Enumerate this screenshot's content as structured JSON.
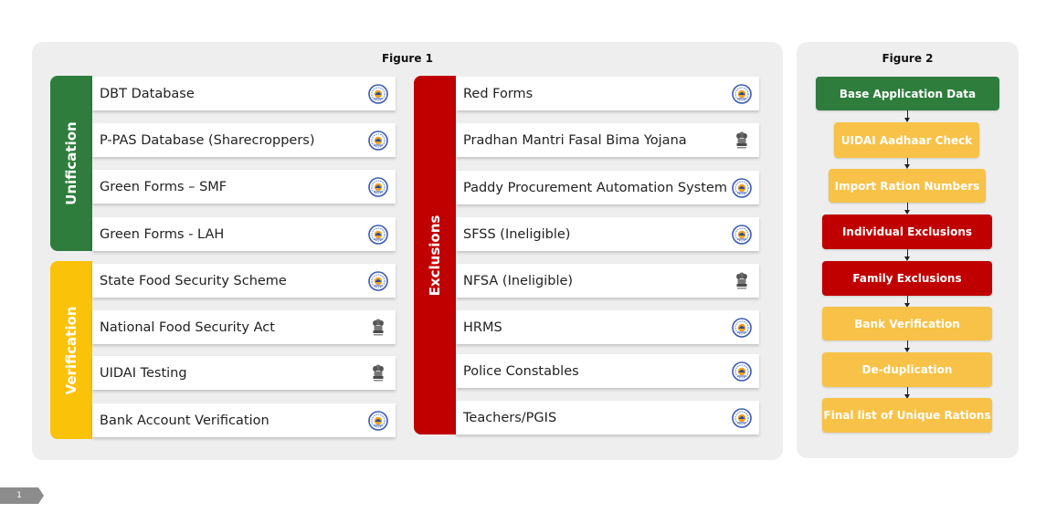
{
  "colors": {
    "green": "#2e7d3d",
    "yellow": "#fbc20a",
    "red": "#c00000",
    "light_yellow": "#f7c247",
    "panel": "#eeeeee"
  },
  "figure1": {
    "title": "Figure 1",
    "unification": {
      "label": "Unification",
      "rows": [
        {
          "text": "DBT Database",
          "emblem": "odisha-emblem-icon"
        },
        {
          "text": "P-PAS Database (Sharecroppers)",
          "emblem": "odisha-emblem-icon"
        },
        {
          "text": "Green Forms – SMF",
          "emblem": "odisha-emblem-icon"
        },
        {
          "text": "Green Forms - LAH",
          "emblem": "odisha-emblem-icon"
        }
      ]
    },
    "verification": {
      "label": "Verification",
      "rows": [
        {
          "text": "State Food Security Scheme",
          "emblem": "odisha-emblem-icon"
        },
        {
          "text": "National Food Security Act",
          "emblem": "india-emblem-icon"
        },
        {
          "text": "UIDAI Testing",
          "emblem": "india-emblem-icon"
        },
        {
          "text": "Bank Account Verification",
          "emblem": "odisha-emblem-icon"
        }
      ]
    },
    "exclusions": {
      "label": "Exclusions",
      "rows": [
        {
          "text": "Red Forms",
          "emblem": "odisha-emblem-icon"
        },
        {
          "text": "Pradhan Mantri Fasal Bima Yojana",
          "emblem": "india-emblem-icon"
        },
        {
          "text": "Paddy Procurement Automation System",
          "emblem": "odisha-emblem-icon"
        },
        {
          "text": "SFSS (Ineligible)",
          "emblem": "odisha-emblem-icon"
        },
        {
          "text": "NFSA (Ineligible)",
          "emblem": "india-emblem-icon"
        },
        {
          "text": "HRMS",
          "emblem": "odisha-emblem-icon"
        },
        {
          "text": "Police Constables",
          "emblem": "odisha-emblem-icon"
        },
        {
          "text": "Teachers/PGIS",
          "emblem": "odisha-emblem-icon"
        }
      ]
    }
  },
  "figure2": {
    "title": "Figure 2",
    "steps": [
      {
        "label": "Base Application Data",
        "color": "#2e7d3d"
      },
      {
        "label": "UIDAI Aadhaar Check",
        "color": "#f7c247"
      },
      {
        "label": "Import Ration Numbers",
        "color": "#f7c247"
      },
      {
        "label": "Individual Exclusions",
        "color": "#c00000"
      },
      {
        "label": "Family Exclusions",
        "color": "#c00000"
      },
      {
        "label": "Bank Verification",
        "color": "#f7c247"
      },
      {
        "label": "De-duplication",
        "color": "#f7c247"
      },
      {
        "label": "Final list of Unique Rations",
        "color": "#f7c247"
      }
    ]
  },
  "page_number": "1"
}
